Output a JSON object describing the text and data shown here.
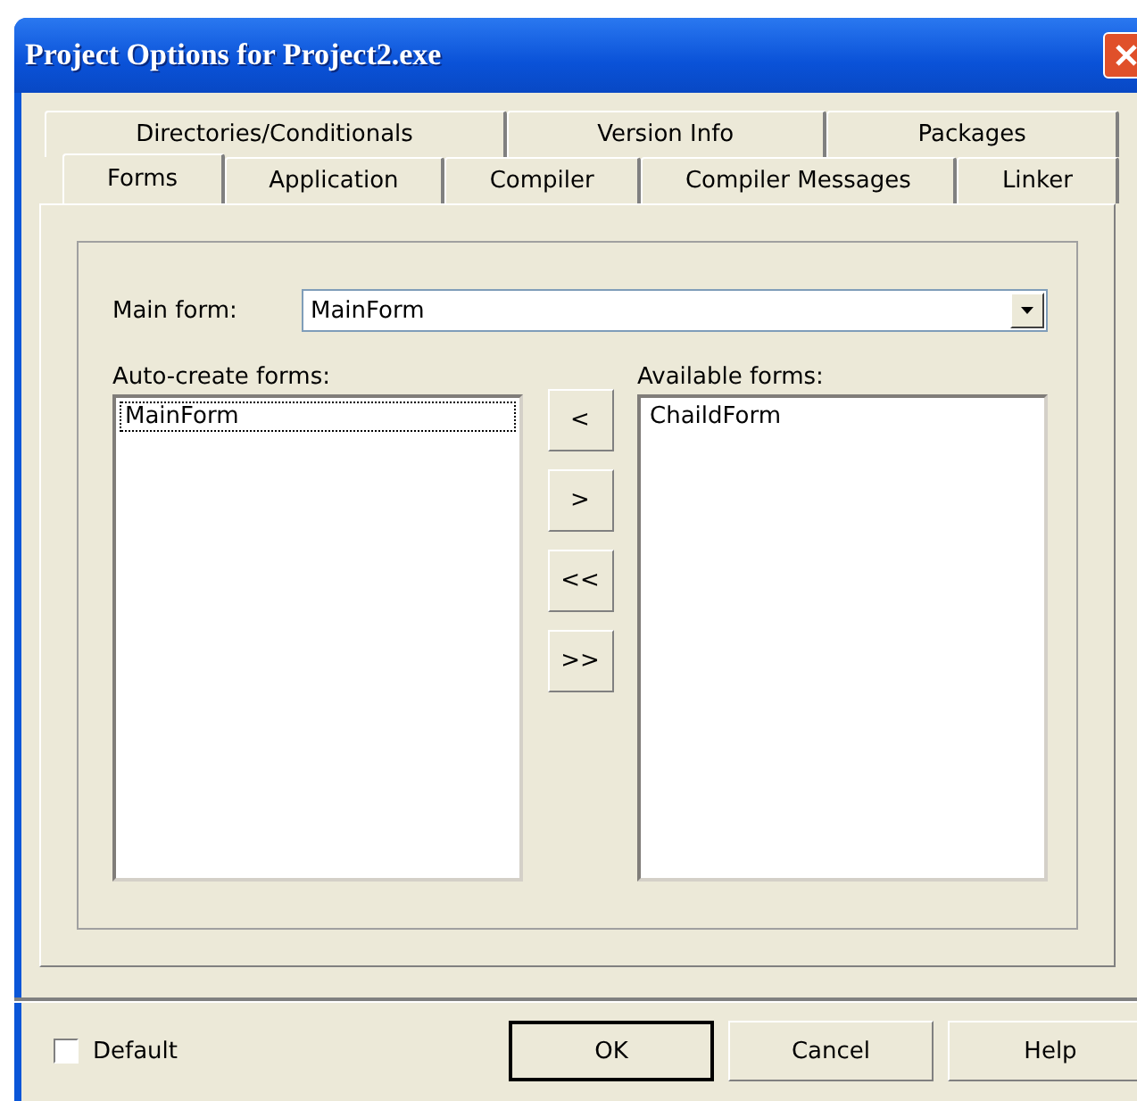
{
  "window": {
    "title": "Project Options for Project2.exe"
  },
  "tab_rows": [
    [
      {
        "label": "Directories/Conditionals",
        "selected": false
      },
      {
        "label": "Version Info",
        "selected": false
      },
      {
        "label": "Packages",
        "selected": false
      }
    ],
    [
      {
        "label": "Forms",
        "selected": true
      },
      {
        "label": "Application",
        "selected": false
      },
      {
        "label": "Compiler",
        "selected": false
      },
      {
        "label": "Compiler Messages",
        "selected": false
      },
      {
        "label": "Linker",
        "selected": false
      }
    ]
  ],
  "main_form": {
    "label": "Main form:",
    "value": "MainForm"
  },
  "auto_create": {
    "label": "Auto-create forms:",
    "items": [
      {
        "label": "MainForm",
        "selected": true
      }
    ]
  },
  "move_buttons": [
    "<",
    ">",
    "<<",
    ">>"
  ],
  "available": {
    "label": "Available forms:",
    "items": [
      {
        "label": "ChaildForm",
        "selected": false
      }
    ]
  },
  "default_checkbox": {
    "label": "Default",
    "checked": false
  },
  "buttons": [
    {
      "label": "OK",
      "default": true
    },
    {
      "label": "Cancel",
      "default": false
    },
    {
      "label": "Help",
      "default": false
    }
  ]
}
